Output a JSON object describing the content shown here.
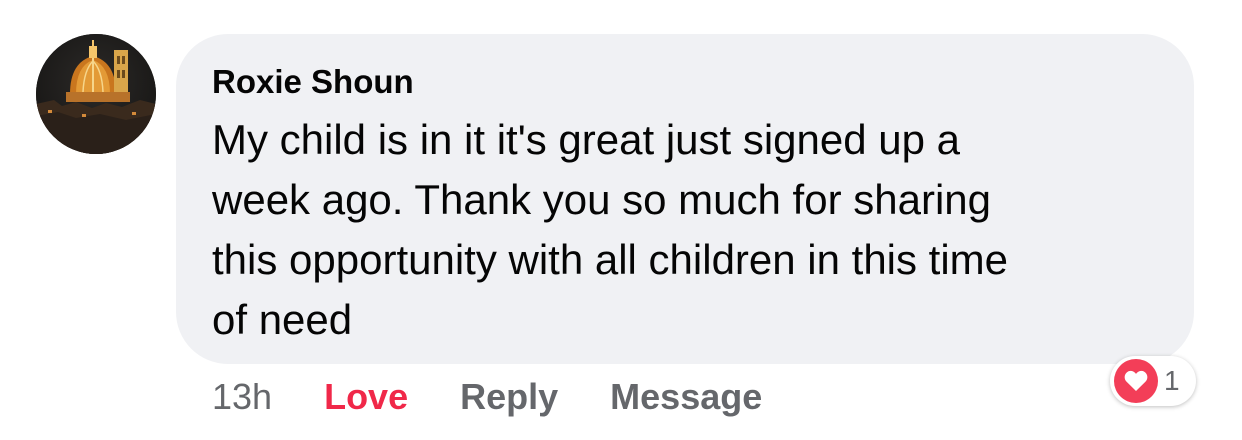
{
  "comment": {
    "author": "Roxie Shoun",
    "text": "My child is in it it's great just signed up a\nweek ago. Thank you so much for sharing\nthis opportunity with all children in this time\nof need",
    "avatar_icon": "cathedral-dome-photo"
  },
  "actions": {
    "timestamp": "13h",
    "love_label": "Love",
    "reply_label": "Reply",
    "message_label": "Message"
  },
  "reactions": {
    "icon": "heart-icon",
    "count": "1"
  },
  "colors": {
    "bubble": "#f0f1f4",
    "love": "#f02849",
    "muted": "#65676b",
    "heart_badge": "#f33e58"
  }
}
